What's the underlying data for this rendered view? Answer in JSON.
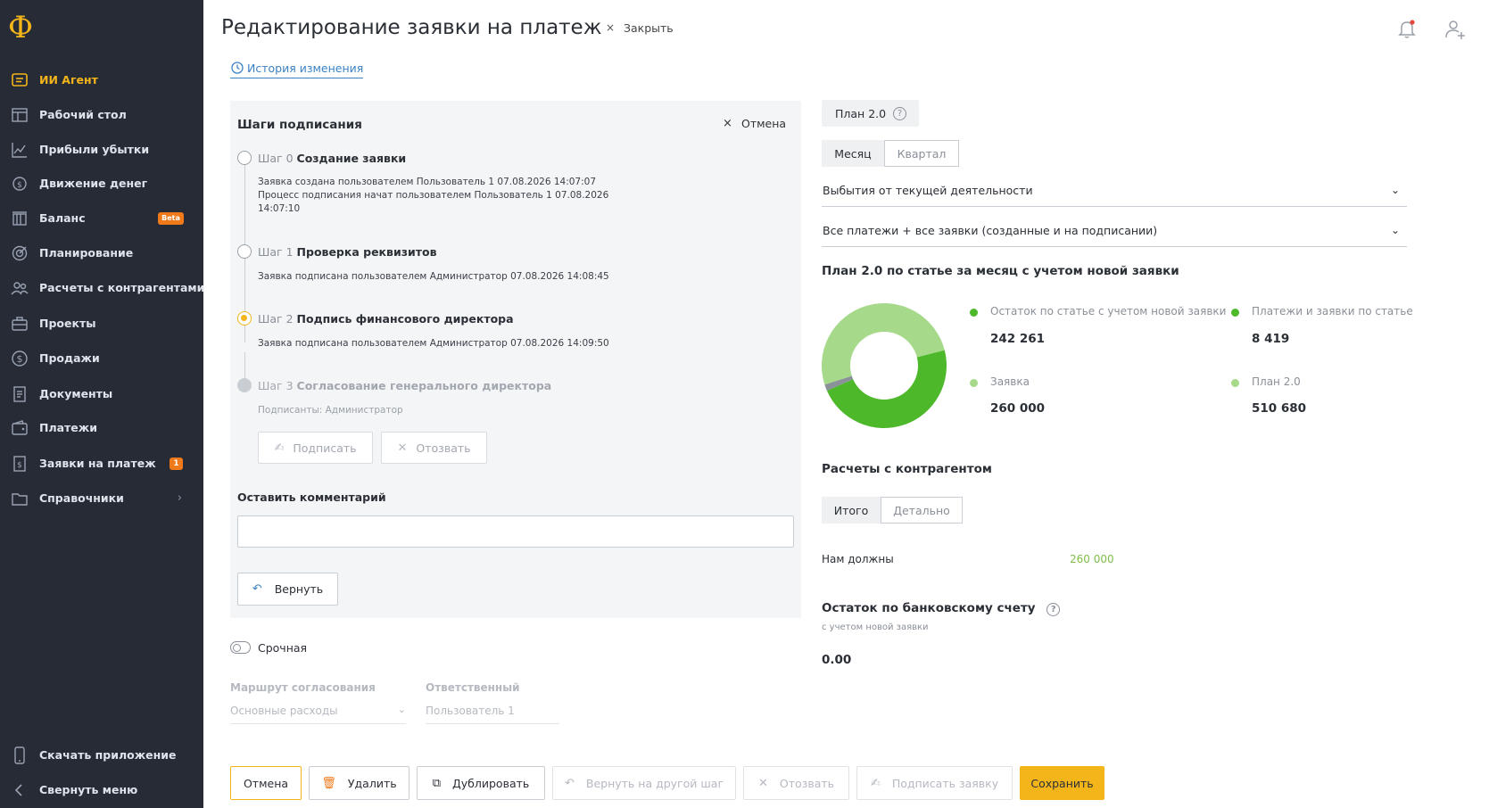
{
  "sidebar": {
    "logo": "Ф",
    "items": [
      {
        "label": "ИИ Агент",
        "icon": "chat-icon"
      },
      {
        "label": "Рабочий стол",
        "icon": "dashboard-icon"
      },
      {
        "label": "Прибыли убытки",
        "icon": "chart-icon"
      },
      {
        "label": "Движение денег",
        "icon": "money-flow-icon"
      },
      {
        "label": "Баланс",
        "icon": "balance-icon",
        "badge": "Beta"
      },
      {
        "label": "Планирование",
        "icon": "target-icon"
      },
      {
        "label": "Расчеты с контрагентами",
        "icon": "users-icon"
      },
      {
        "label": "Проекты",
        "icon": "briefcase-icon"
      },
      {
        "label": "Продажи",
        "icon": "dollar-icon"
      },
      {
        "label": "Документы",
        "icon": "documents-icon"
      },
      {
        "label": "Платежи",
        "icon": "wallet-icon"
      },
      {
        "label": "Заявки на платеж",
        "icon": "request-icon",
        "badge": "1"
      },
      {
        "label": "Справочники",
        "icon": "folder-icon"
      }
    ],
    "download": "Скачать приложение",
    "collapse": "Свернуть меню"
  },
  "header": {
    "title": "Редактирование заявки на платеж",
    "close_x": "×",
    "close_label": "Закрыть",
    "history_label": "История изменения"
  },
  "steps": {
    "title": "Шаги подписания",
    "cancel_x": "×",
    "cancel_label": "Отмена",
    "list": [
      {
        "num": "Шаг 0",
        "name": "Создание заявки",
        "note": "Заявка создана пользователем Пользователь 1 07.08.2026 14:07:07 Процесс подписания начат пользователем Пользователь 1 07.08.2026 14:07:10"
      },
      {
        "num": "Шаг 1",
        "name": "Проверка реквизитов",
        "note": "Заявка подписана пользователем Администратор 07.08.2026 14:08:45"
      },
      {
        "num": "Шаг 2",
        "name": "Подпись финансового директора",
        "note": "Заявка подписана пользователем Администратор 07.08.2026 14:09:50"
      },
      {
        "num": "Шаг 3",
        "name": "Согласование генерального директора",
        "note": "Подписанты: Администратор"
      }
    ],
    "sign_label": "Подписать",
    "revoke_label": "Отозвать",
    "comment_label": "Оставить комментарий",
    "comment_value": "",
    "return_label": "Вернуть"
  },
  "form": {
    "urgent_label": "Срочная",
    "route_label": "Маршрут согласования",
    "route_value": "Основные расходы",
    "responsible_label": "Ответственный",
    "responsible_value": "Пользователь 1"
  },
  "right": {
    "plan_chip": "План 2.0",
    "period_tabs": [
      "Месяц",
      "Квартал"
    ],
    "dropdown1": "Выбытия от текущей деятельности",
    "dropdown2": "Все платежи + все заявки (созданные и на подписании)",
    "plan_title": "План 2.0 по статье за месяц с учетом новой заявки",
    "legend": [
      {
        "label": "Остаток по статье с учетом новой заявки",
        "value": "242 261",
        "color": "#4cb82a"
      },
      {
        "label": "Платежи и заявки по статье",
        "value": "8 419",
        "color": "#4cb82a"
      },
      {
        "label": "Заявка",
        "value": "260 000",
        "color": "#a6d98a"
      },
      {
        "label": "План 2.0",
        "value": "510 680",
        "color": "#a6d98a"
      }
    ],
    "settlements_title": "Расчеты с контрагентом",
    "settle_tabs": [
      "Итого",
      "Детально"
    ],
    "owed_label": "Нам должны",
    "owed_value": "260 000",
    "bank_title": "Остаток по банковскому счету",
    "bank_note": "с учетом новой заявки",
    "bank_value": "0.00"
  },
  "donut": {
    "segments": [
      {
        "name": "Остаток по статье с учетом новой заявки",
        "value": 242261,
        "color": "#4cb82a"
      },
      {
        "name": "Платежи и заявки по статье",
        "value": 8419,
        "color": "#8a9199"
      },
      {
        "name": "Заявка",
        "value": 260000,
        "color": "#a6d98a"
      }
    ]
  },
  "footer": {
    "cancel": "Отмена",
    "delete": "Удалить",
    "duplicate": "Дублировать",
    "return_step": "Вернуть на другой шаг",
    "revoke": "Отозвать",
    "sign": "Подписать заявку",
    "save": "Сохранить"
  }
}
